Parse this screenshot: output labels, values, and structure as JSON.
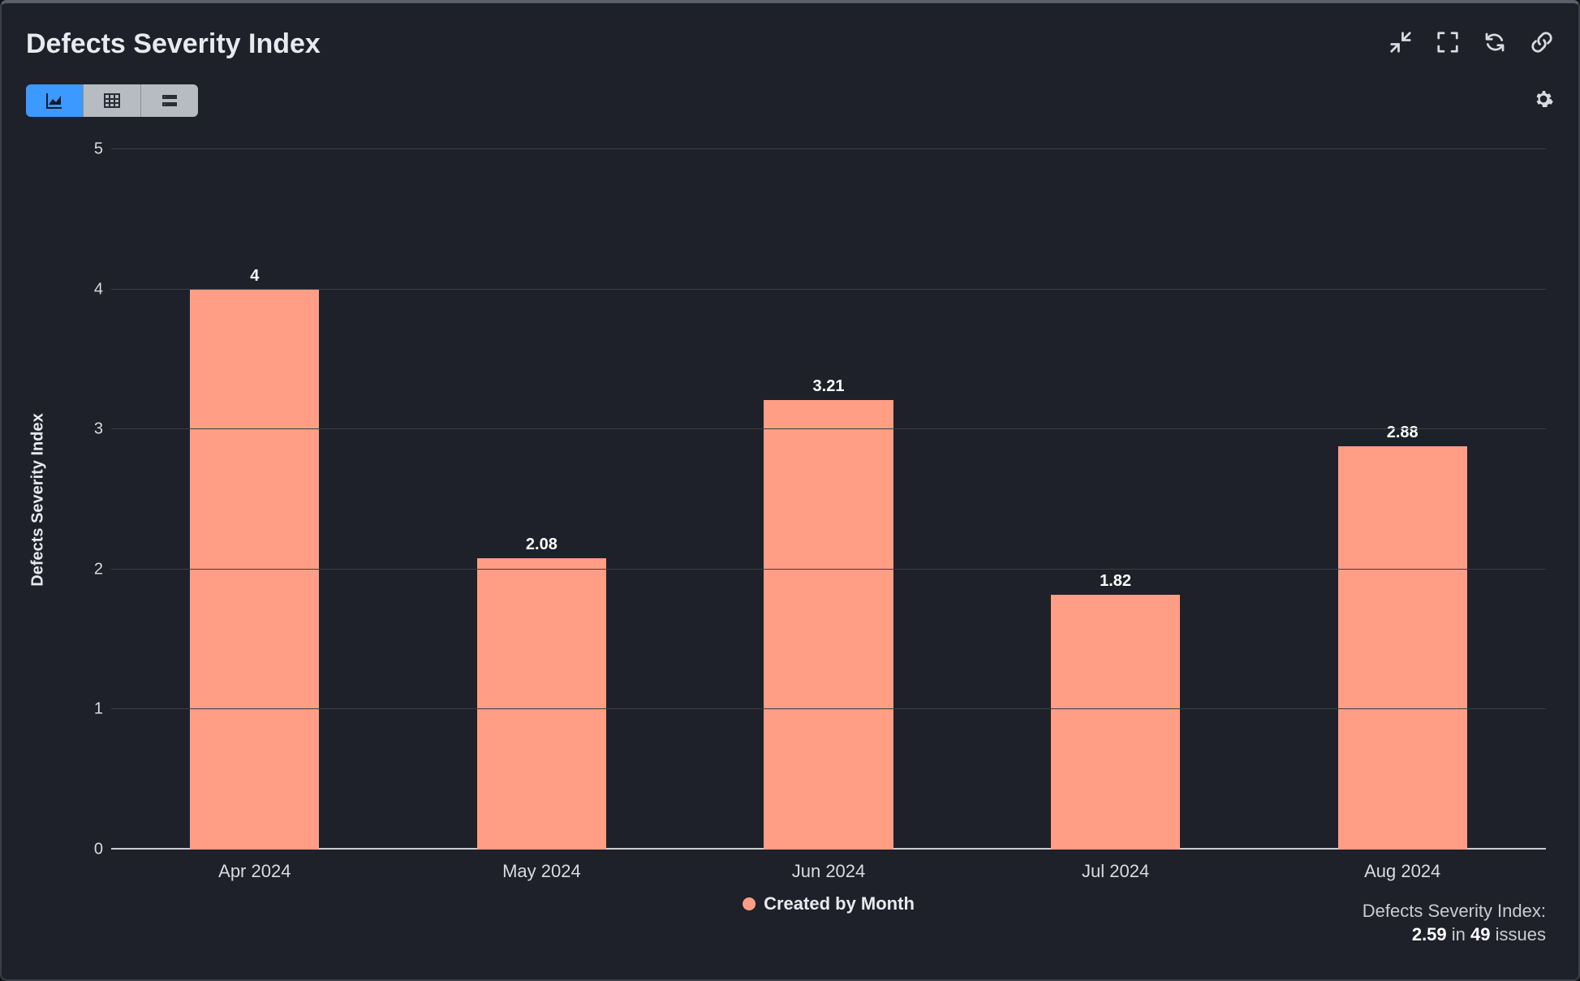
{
  "title": "Defects Severity Index",
  "header_icons": {
    "collapse": "collapse-icon",
    "fullscreen": "fullscreen-icon",
    "refresh": "refresh-icon",
    "link": "link-icon"
  },
  "view_toggle": {
    "chart": "chart-view",
    "table": "table-view",
    "list": "list-view",
    "active": "chart"
  },
  "settings_icon": "gear-icon",
  "chart_data": {
    "type": "bar",
    "categories": [
      "Apr 2024",
      "May 2024",
      "Jun 2024",
      "Jul 2024",
      "Aug 2024"
    ],
    "values": [
      4,
      2.08,
      3.21,
      1.82,
      2.88
    ],
    "value_labels": [
      "4",
      "2.08",
      "3.21",
      "1.82",
      "2.88"
    ],
    "title": "",
    "xlabel": "",
    "ylabel": "Defects Severity Index",
    "ylim": [
      0,
      5
    ],
    "yticks": [
      0,
      1,
      2,
      3,
      4,
      5
    ],
    "bar_color": "#ff9d85",
    "legend": "Created by Month"
  },
  "footer": {
    "label": "Defects Severity Index:",
    "value": "2.59",
    "in_word": "in",
    "count": "49",
    "issues_word": "issues"
  }
}
